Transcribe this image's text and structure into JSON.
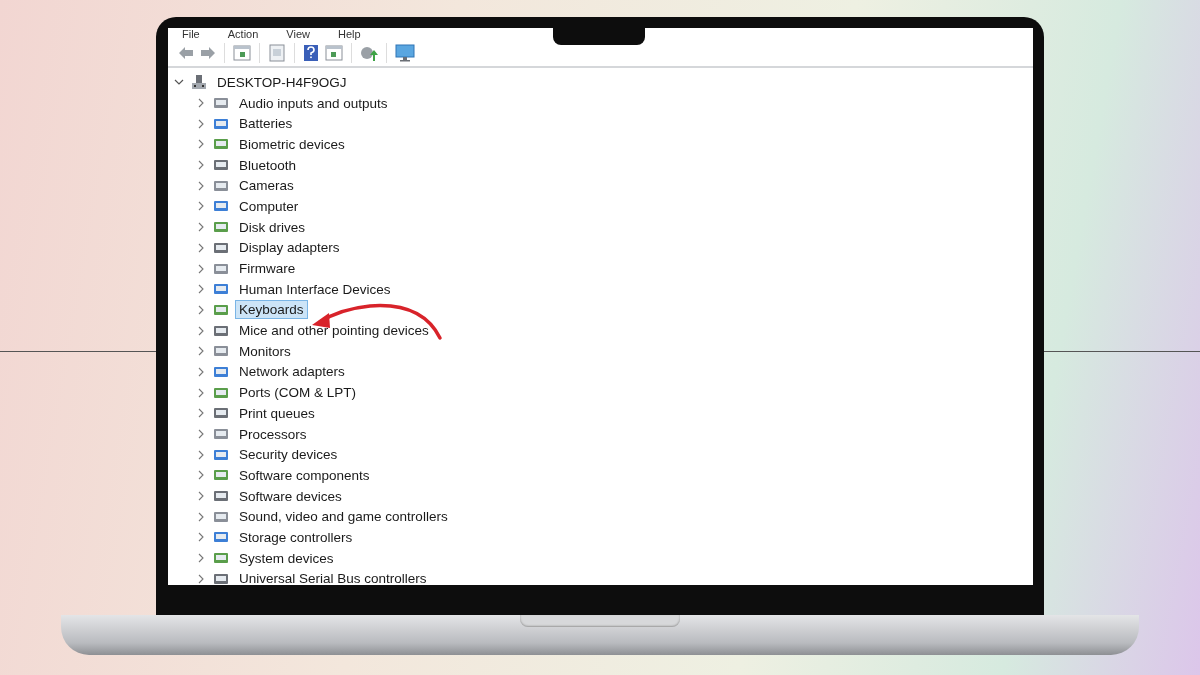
{
  "menu": [
    {
      "label": "File"
    },
    {
      "label": "Action"
    },
    {
      "label": "View"
    },
    {
      "label": "Help"
    }
  ],
  "tree": {
    "label": "DESKTOP-H4F9OGJ",
    "expanded": true,
    "children": [
      {
        "label": "Audio inputs and outputs",
        "expanded": false,
        "selected": false
      },
      {
        "label": "Batteries",
        "expanded": false,
        "selected": false
      },
      {
        "label": "Biometric devices",
        "expanded": false,
        "selected": false
      },
      {
        "label": "Bluetooth",
        "expanded": false,
        "selected": false
      },
      {
        "label": "Cameras",
        "expanded": false,
        "selected": false
      },
      {
        "label": "Computer",
        "expanded": false,
        "selected": false
      },
      {
        "label": "Disk drives",
        "expanded": false,
        "selected": false
      },
      {
        "label": "Display adapters",
        "expanded": false,
        "selected": false
      },
      {
        "label": "Firmware",
        "expanded": false,
        "selected": false
      },
      {
        "label": "Human Interface Devices",
        "expanded": false,
        "selected": false
      },
      {
        "label": "Keyboards",
        "expanded": false,
        "selected": true
      },
      {
        "label": "Mice and other pointing devices",
        "expanded": false,
        "selected": false
      },
      {
        "label": "Monitors",
        "expanded": false,
        "selected": false
      },
      {
        "label": "Network adapters",
        "expanded": false,
        "selected": false
      },
      {
        "label": "Ports (COM & LPT)",
        "expanded": false,
        "selected": false
      },
      {
        "label": "Print queues",
        "expanded": false,
        "selected": false
      },
      {
        "label": "Processors",
        "expanded": false,
        "selected": false
      },
      {
        "label": "Security devices",
        "expanded": false,
        "selected": false
      },
      {
        "label": "Software components",
        "expanded": false,
        "selected": false
      },
      {
        "label": "Software devices",
        "expanded": false,
        "selected": false
      },
      {
        "label": "Sound, video and game controllers",
        "expanded": false,
        "selected": false
      },
      {
        "label": "Storage controllers",
        "expanded": false,
        "selected": false
      },
      {
        "label": "System devices",
        "expanded": false,
        "selected": false
      },
      {
        "label": "Universal Serial Bus controllers",
        "expanded": false,
        "selected": false
      }
    ]
  }
}
